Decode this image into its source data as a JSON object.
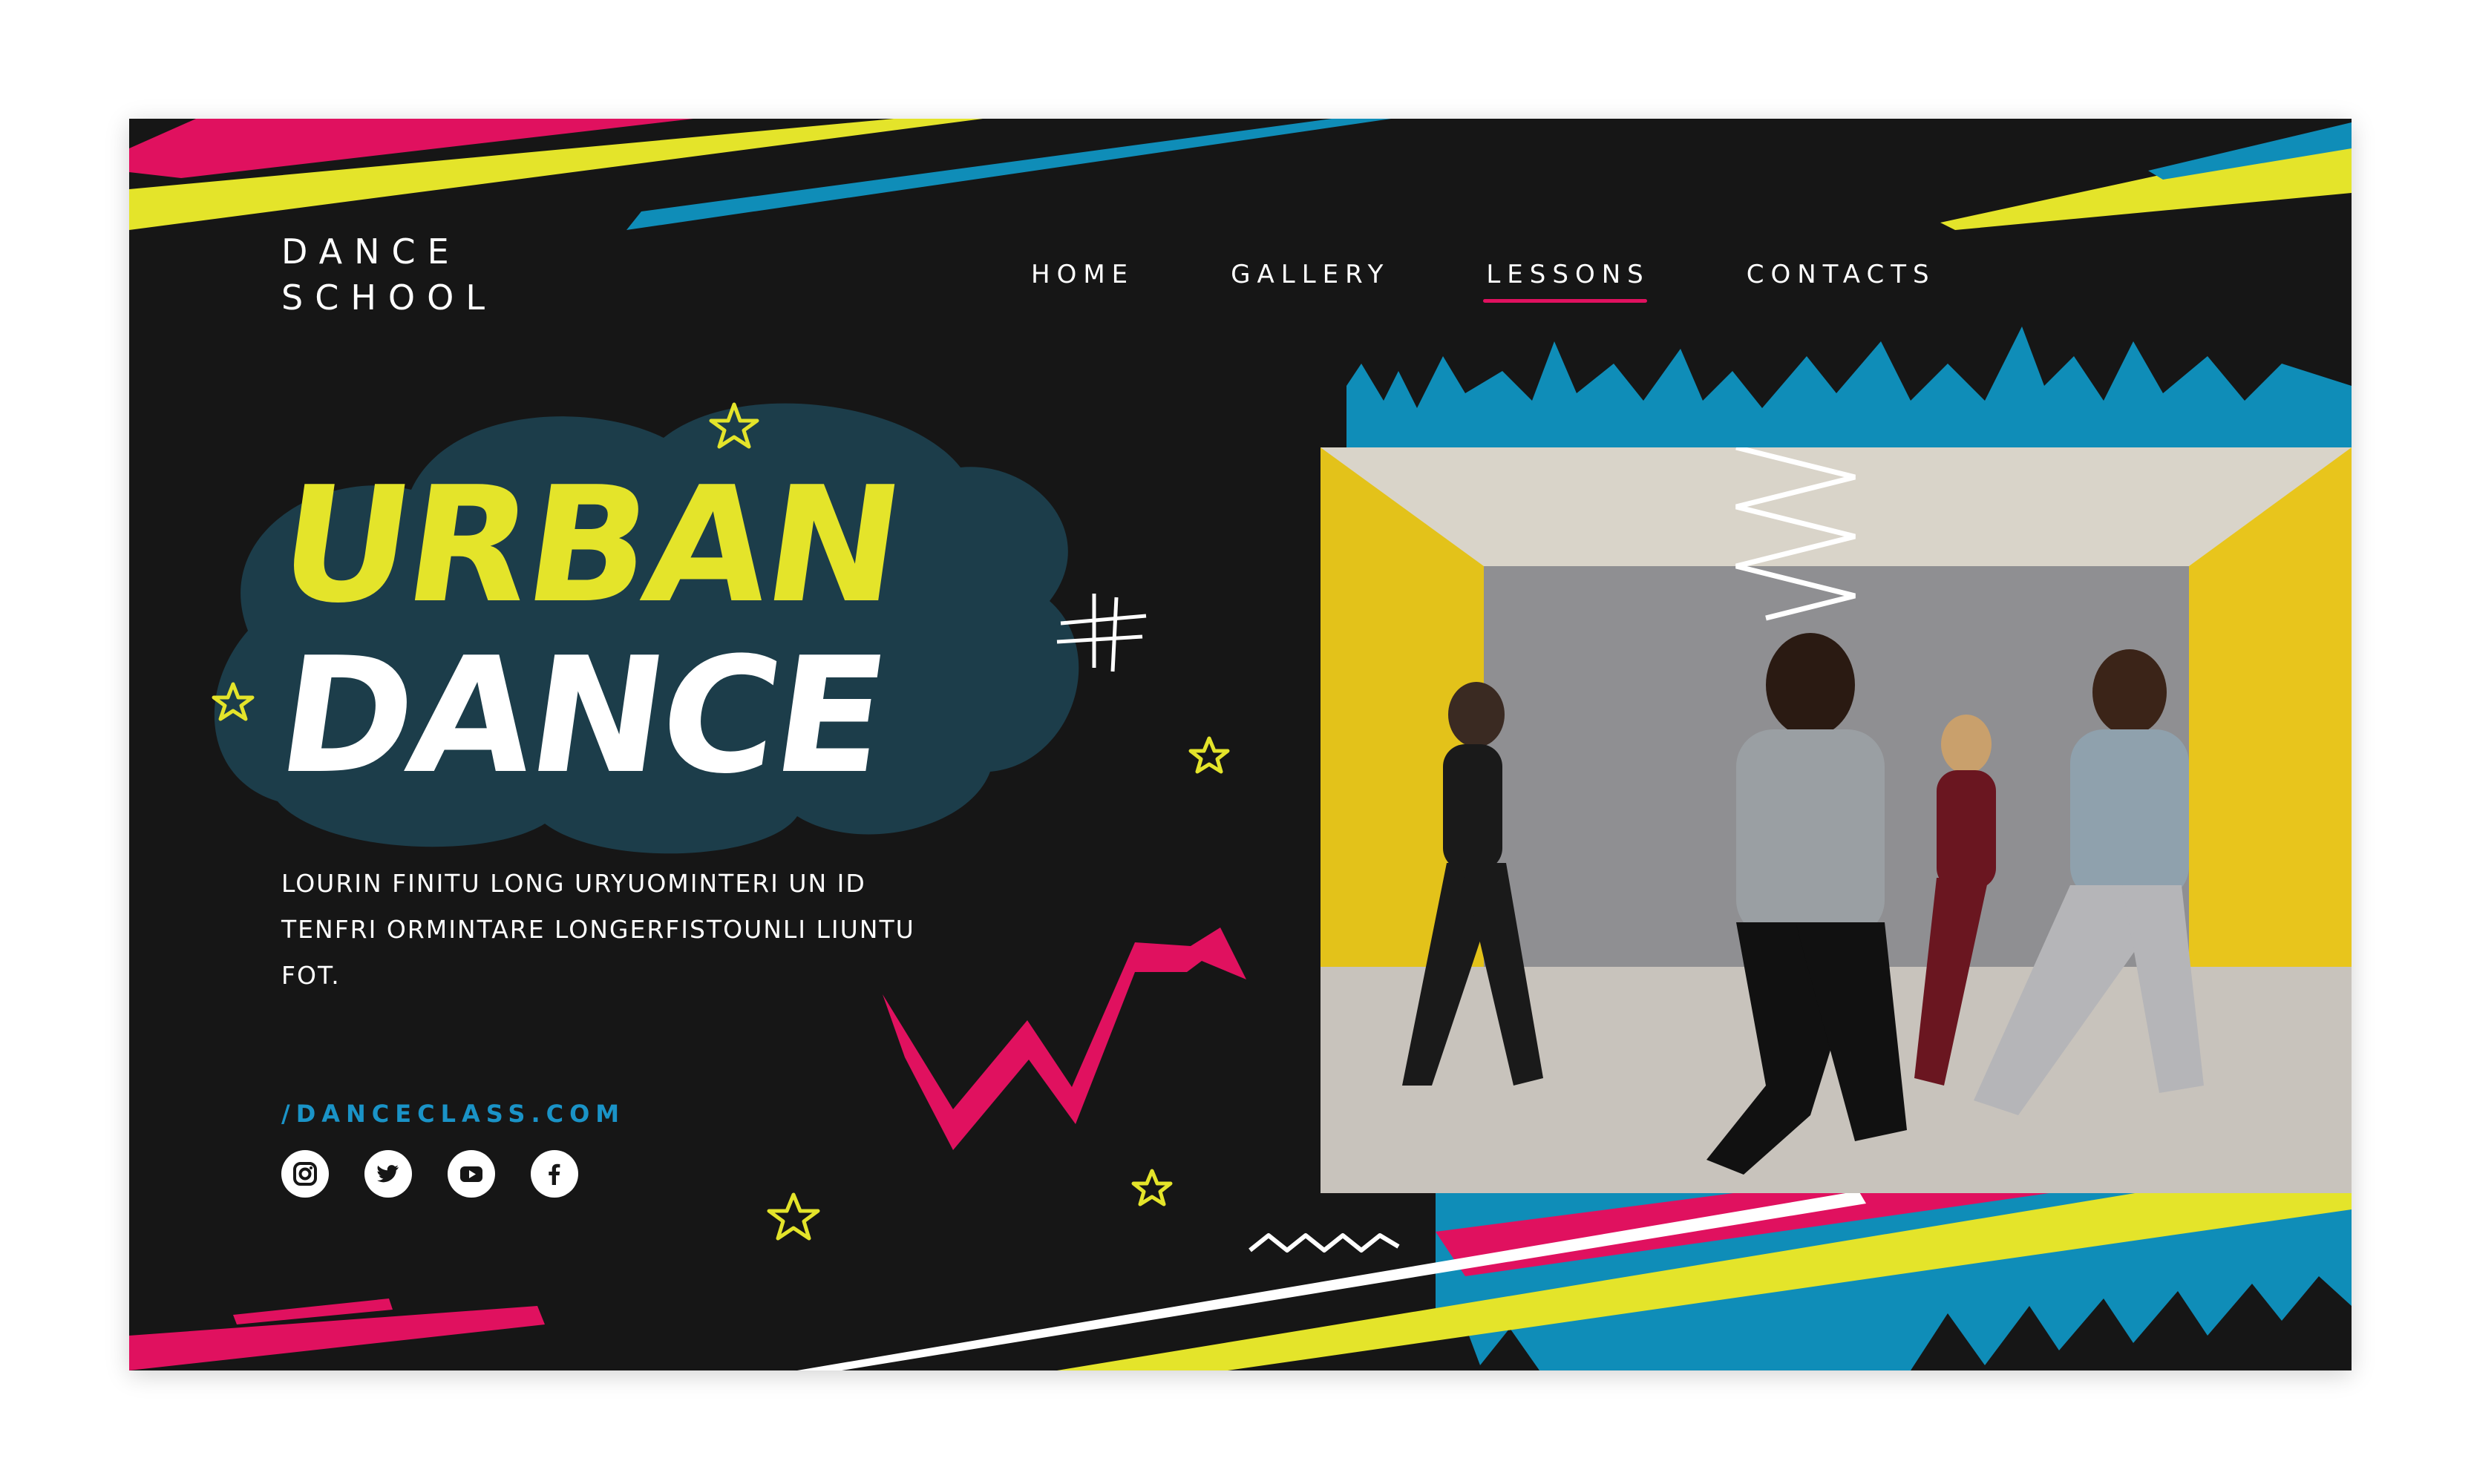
{
  "brand": {
    "line1": "DANCE",
    "line2": "SCHOOL"
  },
  "nav": {
    "items": [
      {
        "label": "HOME",
        "active": false
      },
      {
        "label": "GALLERY",
        "active": false
      },
      {
        "label": "LESSONS",
        "active": true
      },
      {
        "label": "CONTACTS",
        "active": false
      }
    ]
  },
  "hero": {
    "title_line1": "URBAN",
    "title_line2": "DANCE",
    "description": "LOURIN FINITU LONG URYUOMINTERI UN ID TENFRI ORMINTARE LONGERFISTOUNLI LIUNTU FOT.",
    "website": "/DANCECLASS.COM"
  },
  "socials": [
    {
      "icon": "instagram-icon"
    },
    {
      "icon": "twitter-icon"
    },
    {
      "icon": "youtube-icon"
    },
    {
      "icon": "facebook-icon"
    }
  ],
  "colors": {
    "background": "#161616",
    "yellow": "#e4e42a",
    "pink": "#e0115f",
    "blue": "#0f8db8",
    "blob": "#1c3d4a",
    "white": "#ffffff"
  }
}
